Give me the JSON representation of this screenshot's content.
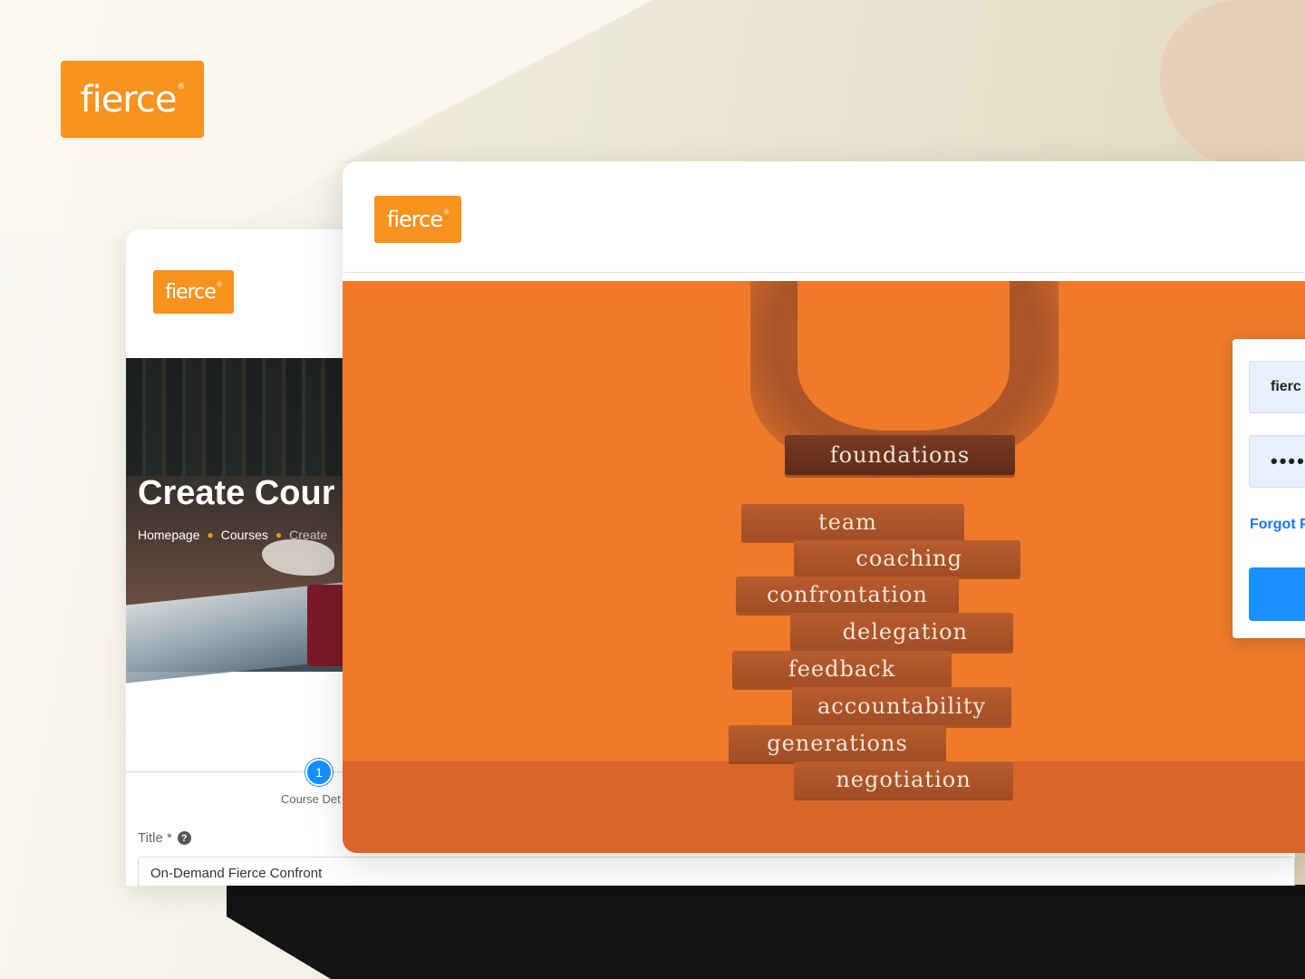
{
  "brand": {
    "logo_text": "fierce",
    "registered_mark": "®",
    "accent_color": "#f7931e"
  },
  "colors": {
    "hero_orange": "#ee7a2a",
    "primary_blue": "#1890ff",
    "dark_panel": "#131313"
  },
  "back_window": {
    "page_title": "Create Cour",
    "breadcrumbs": [
      "Homepage",
      "Courses",
      "Create"
    ],
    "stepper": {
      "step_number": "1",
      "step_label": "Course Det"
    },
    "form": {
      "title_label": "Title *",
      "help_icon": "?",
      "title_value": "On-Demand Fierce Confront"
    }
  },
  "front_window": {
    "hero_words": {
      "held": "foundations",
      "stack": [
        "team",
        "coaching",
        "confrontation",
        "delegation",
        "feedback",
        "accountability",
        "generations",
        "negotiation"
      ]
    },
    "login": {
      "username_value": "fierc",
      "password_value": "•••••",
      "forgot_link": "Forgot P",
      "submit_label": ""
    }
  }
}
